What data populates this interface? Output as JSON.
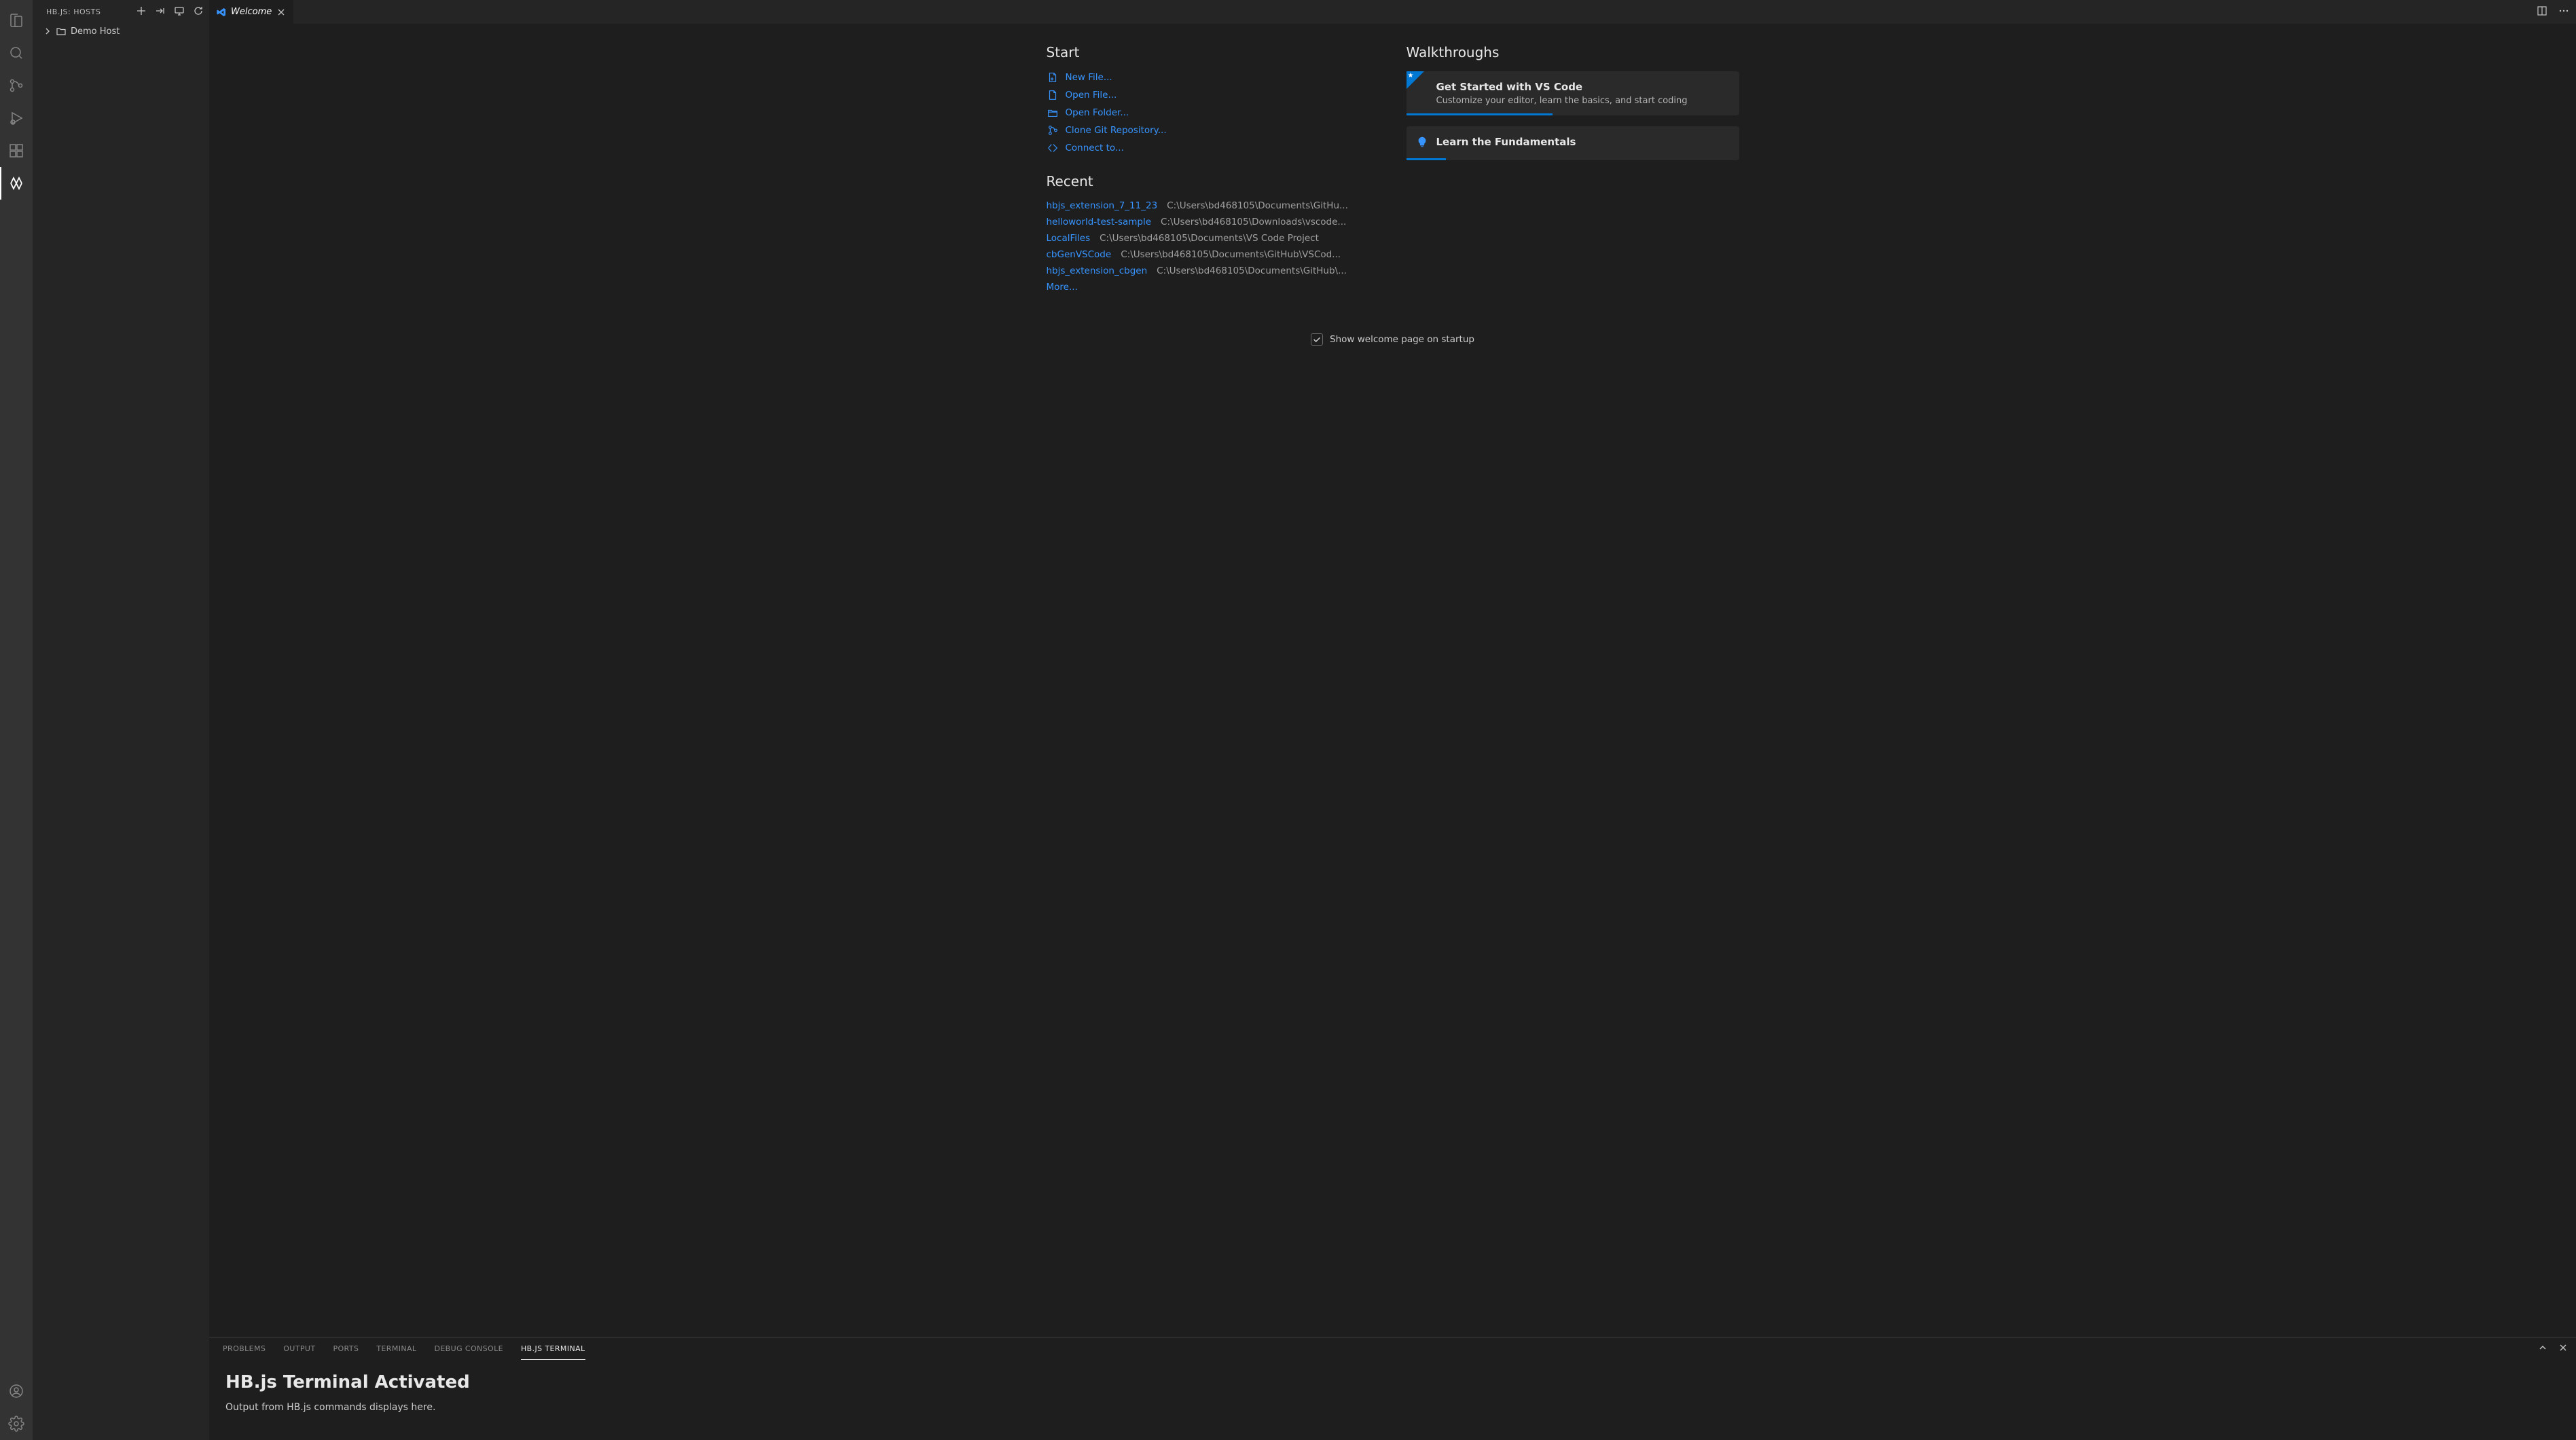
{
  "sidebar": {
    "title": "HB.JS: HOSTS",
    "tree_item": "Demo Host"
  },
  "tab": {
    "label": "Welcome"
  },
  "welcome": {
    "start_heading": "Start",
    "start_items": [
      "New File...",
      "Open File...",
      "Open Folder...",
      "Clone Git Repository...",
      "Connect to..."
    ],
    "recent_heading": "Recent",
    "recent": [
      {
        "name": "hbjs_extension_7_11_23",
        "path": "C:\\Users\\bd468105\\Documents\\GitHu..."
      },
      {
        "name": "helloworld-test-sample",
        "path": "C:\\Users\\bd468105\\Downloads\\vscode..."
      },
      {
        "name": "LocalFiles",
        "path": "C:\\Users\\bd468105\\Documents\\VS Code Project"
      },
      {
        "name": "cbGenVSCode",
        "path": "C:\\Users\\bd468105\\Documents\\GitHub\\VSCod..."
      },
      {
        "name": "hbjs_extension_cbgen",
        "path": "C:\\Users\\bd468105\\Documents\\GitHub\\..."
      }
    ],
    "more": "More...",
    "walkthroughs_heading": "Walkthroughs",
    "walkthroughs": [
      {
        "title": "Get Started with VS Code",
        "desc": "Customize your editor, learn the basics, and start coding",
        "progress_pct": 44
      },
      {
        "title": "Learn the Fundamentals",
        "desc": "",
        "progress_pct": 12
      }
    ],
    "startup_label": "Show welcome page on startup"
  },
  "panel": {
    "tabs": [
      "PROBLEMS",
      "OUTPUT",
      "PORTS",
      "TERMINAL",
      "DEBUG CONSOLE",
      "HB.JS TERMINAL"
    ],
    "active_tab_index": 5,
    "heading": "HB.js Terminal Activated",
    "body": "Output from HB.js commands displays here."
  },
  "colors": {
    "link": "#3794ff",
    "accent": "#0078d4"
  }
}
